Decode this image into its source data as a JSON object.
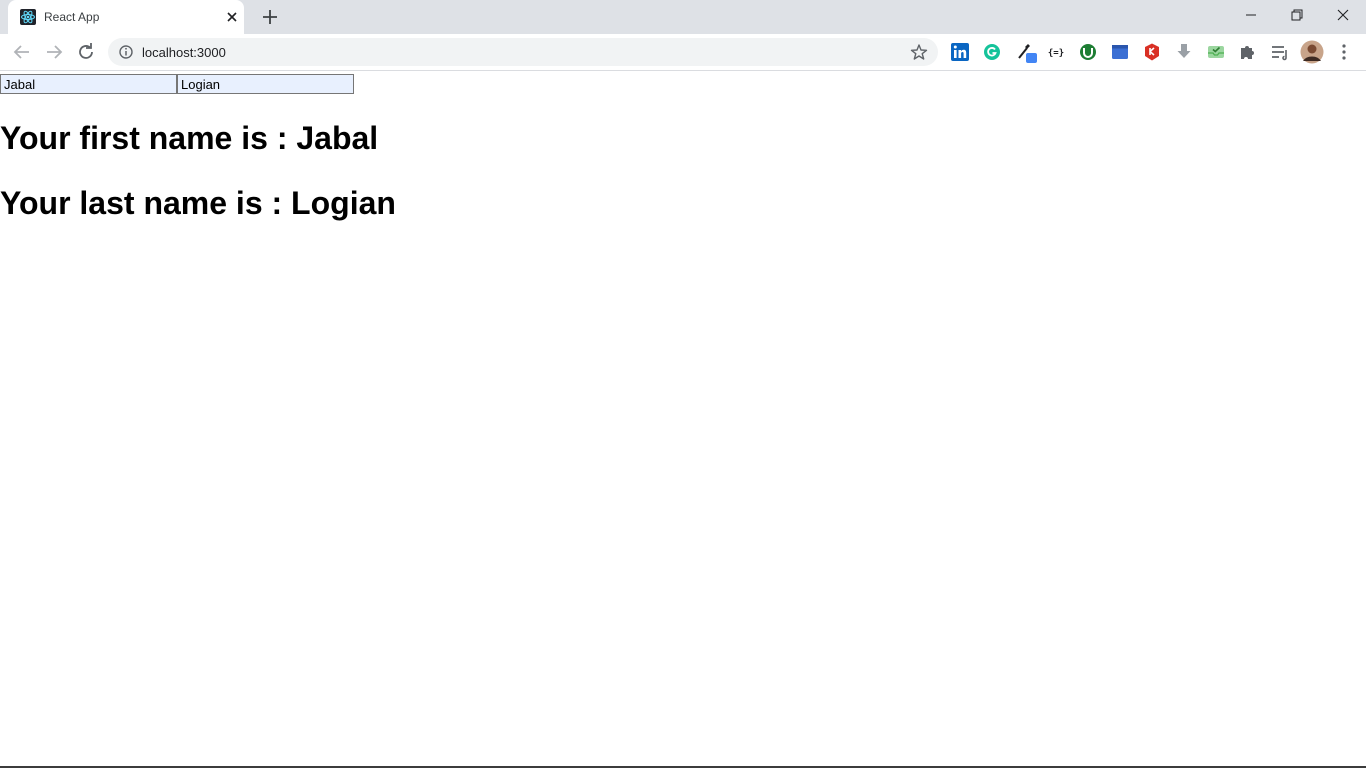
{
  "browser": {
    "tab": {
      "title": "React App",
      "favicon": "react-logo-icon"
    },
    "address_bar": {
      "url": "localhost:3000"
    },
    "extensions": [
      "linkedin-icon",
      "grammarly-icon",
      "color-picker-icon",
      "json-viewer-icon",
      "ublock-icon",
      "window-icon",
      "shield-icon",
      "download-icon",
      "inbox-check-icon",
      "puzzle-icon",
      "reading-list-icon",
      "profile-avatar"
    ]
  },
  "form": {
    "first_name_value": "Jabal",
    "last_name_value": "Logian"
  },
  "output": {
    "first_prefix": "Your first name is : ",
    "first_name": "Jabal",
    "last_prefix": "Your last name is : ",
    "last_name": "Logian"
  },
  "colors": {
    "tabstrip_bg": "#dee1e6",
    "omnibox_bg": "#f1f3f4",
    "input_bg": "#e8f0fe",
    "linkedin": "#0a66c2",
    "grammarly": "#15c39a"
  }
}
